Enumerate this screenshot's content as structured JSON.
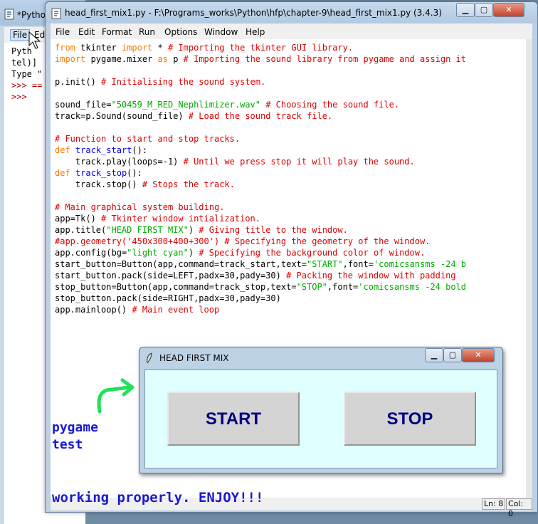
{
  "shell": {
    "title": "*Pytho",
    "menu": [
      "File",
      "Ed"
    ],
    "lines": [
      "Pyth",
      "tel)]",
      "Type \"",
      ">>> ==",
      ">>>"
    ]
  },
  "editor": {
    "title": "head_first_mix1.py - F:\\Programs_works\\Python\\hfp\\chapter-9\\head_first_mix1.py (3.4.3)",
    "menu": [
      "File",
      "Edit",
      "Format",
      "Run",
      "Options",
      "Window",
      "Help"
    ],
    "code_lines": [
      [
        [
          "kw",
          "from"
        ],
        [
          "n",
          " tkinter "
        ],
        [
          "kw",
          "import"
        ],
        [
          "n",
          " * "
        ],
        [
          "cm",
          "# Importing the tkinter GUI library."
        ]
      ],
      [
        [
          "kw",
          "import"
        ],
        [
          "n",
          " pygame.mixer "
        ],
        [
          "kw",
          "as"
        ],
        [
          "n",
          " p "
        ],
        [
          "cm",
          "# Importing the sound library from pygame and assign it"
        ]
      ],
      [
        [
          "n",
          ""
        ]
      ],
      [
        [
          "n",
          "p.init() "
        ],
        [
          "cm",
          "# Initialising the sound system."
        ]
      ],
      [
        [
          "n",
          ""
        ]
      ],
      [
        [
          "n",
          "sound_file="
        ],
        [
          "st",
          "\"50459_M_RED_Nephlimizer.wav\""
        ],
        [
          "n",
          " "
        ],
        [
          "cm",
          "# Choosing the sound file."
        ]
      ],
      [
        [
          "n",
          "track=p.Sound(sound_file) "
        ],
        [
          "cm",
          "# Load the sound track file."
        ]
      ],
      [
        [
          "n",
          ""
        ]
      ],
      [
        [
          "cm",
          "# Function to start and stop tracks."
        ]
      ],
      [
        [
          "kw",
          "def"
        ],
        [
          "n",
          " "
        ],
        [
          "df",
          "track_start"
        ],
        [
          "n",
          "():"
        ]
      ],
      [
        [
          "n",
          "    track.play(loops=-1) "
        ],
        [
          "cm",
          "# Until we press stop it will play the sound."
        ]
      ],
      [
        [
          "kw",
          "def"
        ],
        [
          "n",
          " "
        ],
        [
          "df",
          "track_stop"
        ],
        [
          "n",
          "():"
        ]
      ],
      [
        [
          "n",
          "    track.stop() "
        ],
        [
          "cm",
          "# Stops the track."
        ]
      ],
      [
        [
          "n",
          ""
        ]
      ],
      [
        [
          "cm",
          "# Main graphical system building."
        ]
      ],
      [
        [
          "n",
          "app=Tk() "
        ],
        [
          "cm",
          "# Tkinter window intialization."
        ]
      ],
      [
        [
          "n",
          "app.title("
        ],
        [
          "st",
          "\"HEAD FIRST MIX\""
        ],
        [
          "n",
          ") "
        ],
        [
          "cm",
          "# Giving title to the window."
        ]
      ],
      [
        [
          "cm",
          "#app.geometry('450x300+400+300') # Specifying the geometry of the window."
        ]
      ],
      [
        [
          "n",
          "app.config(bg="
        ],
        [
          "st",
          "\"light cyan\""
        ],
        [
          "n",
          ") "
        ],
        [
          "cm",
          "# Specifying the background color of window."
        ]
      ],
      [
        [
          "n",
          "start_button=Button(app,command=track_start,text="
        ],
        [
          "st",
          "\"START\""
        ],
        [
          "n",
          ",font="
        ],
        [
          "st",
          "'comicsansms -24 b"
        ]
      ],
      [
        [
          "n",
          "start_button.pack(side=LEFT,padx=30,pady=30) "
        ],
        [
          "cm",
          "# Packing the window with padding"
        ]
      ],
      [
        [
          "n",
          "stop_button=Button(app,command=track_stop,text="
        ],
        [
          "st",
          "\"STOP\""
        ],
        [
          "n",
          ",font="
        ],
        [
          "st",
          "'comicsansms -24 bold"
        ]
      ],
      [
        [
          "n",
          "stop_button.pack(side=RIGHT,padx=30,pady=30)"
        ]
      ],
      [
        [
          "n",
          "app.mainloop() "
        ],
        [
          "cm",
          "# Main event loop"
        ]
      ]
    ],
    "status": {
      "line": "Ln: 8",
      "col": "Col: 0"
    }
  },
  "annotations": {
    "pygame": "pygame",
    "test": "test",
    "bottom": "working properly. ENJOY!!!",
    "arrow_color": "#22e05a"
  },
  "app_window": {
    "title": "HEAD FIRST MIX",
    "start_label": "START",
    "stop_label": "STOP",
    "bg_color": "#e0ffff"
  }
}
